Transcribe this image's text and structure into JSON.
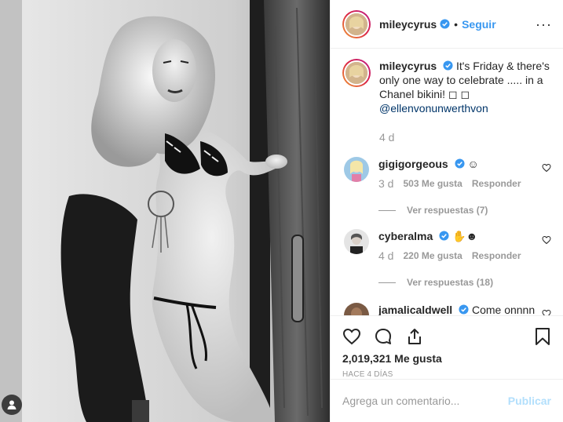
{
  "post": {
    "photo_alt": "",
    "author": {
      "username": "mileycyrus",
      "verified": true,
      "follow_label": "Seguir",
      "separator": "•",
      "more_label": "···"
    },
    "caption": {
      "username": "mileycyrus",
      "text": "It's Friday & there's only one way to celebrate ..... in a Chanel bikini! ",
      "emoji": "◻ ◻",
      "mention": "@ellenvonunwerthvon",
      "time": "4 d"
    },
    "comments": [
      {
        "username": "gigigorgeous",
        "verified": true,
        "text": "☺",
        "time": "3 d",
        "likes": "503 Me gusta",
        "reply_label": "Responder",
        "replies_label": "Ver respuestas (7)"
      },
      {
        "username": "cyberalma",
        "verified": true,
        "text": "✋☻",
        "time": "4 d",
        "likes": "220 Me gusta",
        "reply_label": "Responder",
        "replies_label": "Ver respuestas (18)"
      },
      {
        "username": "jamalicaldwell",
        "verified": true,
        "text": "Come onnnn",
        "time": "",
        "likes": "",
        "reply_label": "",
        "replies_label": ""
      }
    ],
    "likes_count": "2,019,321 Me gusta",
    "time_ago": "HACE 4 DÍAS",
    "add_comment": {
      "placeholder": "Agrega un comentario...",
      "value": "",
      "publish_label": "Publicar"
    }
  },
  "icons": {
    "like": "heart-icon",
    "comment": "comment-icon",
    "share": "share-icon",
    "save": "bookmark-icon",
    "user_tag": "user-tag-icon",
    "verified": "verified-badge-icon",
    "more": "more-options-icon"
  },
  "colors": {
    "link": "#3897f0",
    "mention": "#003569",
    "muted": "#999999",
    "publish_disabled": "#b2dffc",
    "border": "#efefef"
  }
}
